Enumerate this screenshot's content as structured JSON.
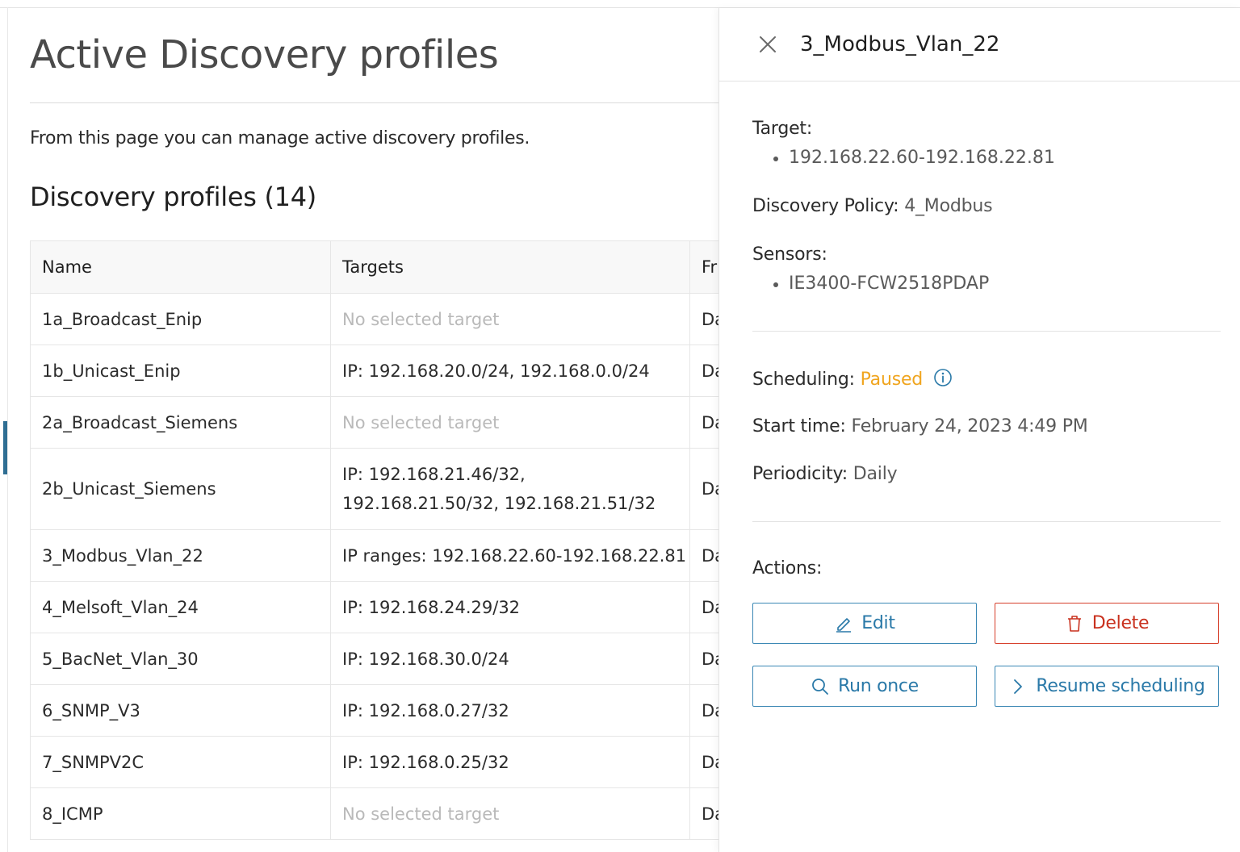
{
  "page": {
    "title": "Active Discovery profiles",
    "description": "From this page you can manage active discovery profiles.",
    "section_title": "Discovery profiles (14)"
  },
  "table": {
    "columns": [
      "Name",
      "Targets",
      "Fr"
    ],
    "rows": [
      {
        "name": "1a_Broadcast_Enip",
        "targets": "No selected target",
        "frequency": "Da"
      },
      {
        "name": "1b_Unicast_Enip",
        "targets": "IP: 192.168.20.0/24, 192.168.0.0/24",
        "frequency": "Da"
      },
      {
        "name": "2a_Broadcast_Siemens",
        "targets": "No selected target",
        "frequency": "Da"
      },
      {
        "name": "2b_Unicast_Siemens",
        "targets": "IP: 192.168.21.46/32, 192.168.21.50/32, 192.168.21.51/32",
        "frequency": "Da"
      },
      {
        "name": "3_Modbus_Vlan_22",
        "targets": "IP ranges: 192.168.22.60-192.168.22.81",
        "frequency": "Da"
      },
      {
        "name": "4_Melsoft_Vlan_24",
        "targets": "IP: 192.168.24.29/32",
        "frequency": "Da"
      },
      {
        "name": "5_BacNet_Vlan_30",
        "targets": "IP: 192.168.30.0/24",
        "frequency": "Da"
      },
      {
        "name": "6_SNMP_V3",
        "targets": "IP: 192.168.0.27/32",
        "frequency": "Da"
      },
      {
        "name": "7_SNMPV2C",
        "targets": "IP: 192.168.0.25/32",
        "frequency": "Da"
      },
      {
        "name": "8_ICMP",
        "targets": "No selected target",
        "frequency": "Da"
      }
    ]
  },
  "panel": {
    "title": "3_Modbus_Vlan_22",
    "target_label": "Target:",
    "targets": [
      "192.168.22.60-192.168.22.81"
    ],
    "policy_label": "Discovery Policy:",
    "policy_value": "4_Modbus",
    "sensors_label": "Sensors:",
    "sensors": [
      "IE3400-FCW2518PDAP"
    ],
    "scheduling_label": "Scheduling:",
    "scheduling_value": "Paused",
    "start_label": "Start time:",
    "start_value": "February 24, 2023 4:49 PM",
    "periodicity_label": "Periodicity:",
    "periodicity_value": "Daily",
    "actions_label": "Actions:",
    "buttons": {
      "edit": "Edit",
      "delete": "Delete",
      "run_once": "Run once",
      "resume": "Resume scheduling"
    }
  },
  "colors": {
    "accent": "#2a79a8",
    "danger": "#c9311e",
    "paused": "#f0a51f",
    "muted": "#b9b9b9"
  },
  "icons": [
    "close-icon",
    "info-icon",
    "pencil-icon",
    "trash-icon",
    "search-icon",
    "chevron-right-icon"
  ]
}
